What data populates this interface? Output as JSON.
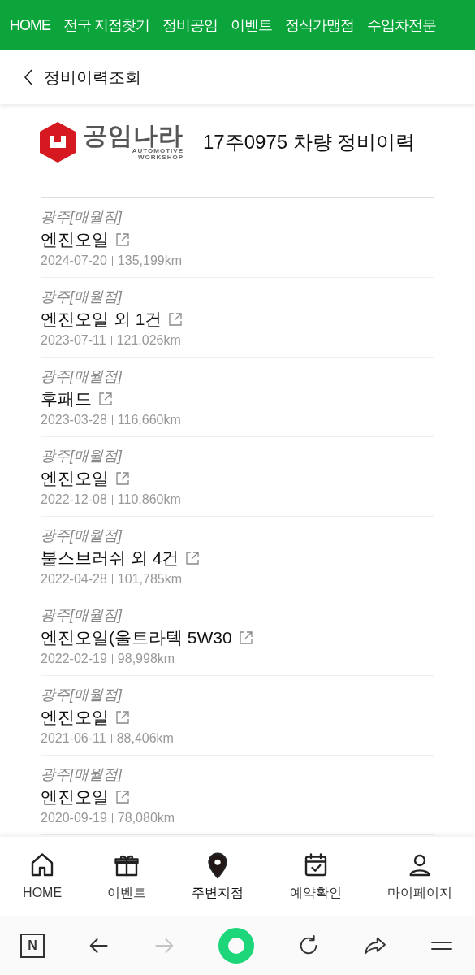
{
  "top_nav": [
    "HOME",
    "전국 지점찾기",
    "정비공임",
    "이벤트",
    "정식가맹점",
    "수입차전문"
  ],
  "header": {
    "title": "정비이력조회"
  },
  "logo": {
    "name": "공임나라",
    "sub1": "AUTOMOTIVE",
    "sub2": "WORKSHOP"
  },
  "page_title": "17주0975 차량 정비이력",
  "records": [
    {
      "branch": "광주[매월점]",
      "title": "엔진오일",
      "date": "2024-07-20",
      "km": "135,199km"
    },
    {
      "branch": "광주[매월점]",
      "title": "엔진오일 외 1건",
      "date": "2023-07-11",
      "km": "121,026km"
    },
    {
      "branch": "광주[매월점]",
      "title": "후패드",
      "date": "2023-03-28",
      "km": "116,660km"
    },
    {
      "branch": "광주[매월점]",
      "title": "엔진오일",
      "date": "2022-12-08",
      "km": "110,860km"
    },
    {
      "branch": "광주[매월점]",
      "title": "불스브러쉬 외 4건",
      "date": "2022-04-28",
      "km": "101,785km"
    },
    {
      "branch": "광주[매월점]",
      "title": "엔진오일(울트라텍 5W30",
      "date": "2022-02-19",
      "km": "98,998km"
    },
    {
      "branch": "광주[매월점]",
      "title": "엔진오일",
      "date": "2021-06-11",
      "km": "88,406km"
    },
    {
      "branch": "광주[매월점]",
      "title": "엔진오일",
      "date": "2020-09-19",
      "km": "78,080km"
    }
  ],
  "bottom_nav": [
    {
      "kind": "home",
      "label": "HOME",
      "selected": false
    },
    {
      "kind": "gift",
      "label": "이벤트",
      "selected": false
    },
    {
      "kind": "pin",
      "label": "주변지점",
      "selected": true
    },
    {
      "kind": "calendar",
      "label": "예약확인",
      "selected": false
    },
    {
      "kind": "user",
      "label": "마이페이지",
      "selected": false
    }
  ],
  "browser_bar": [
    {
      "kind": "n",
      "label": "N",
      "disabled": false
    },
    {
      "kind": "back",
      "disabled": false
    },
    {
      "kind": "forward",
      "disabled": true
    },
    {
      "kind": "home",
      "disabled": false
    },
    {
      "kind": "reload",
      "disabled": false
    },
    {
      "kind": "share",
      "disabled": false
    },
    {
      "kind": "menu",
      "disabled": false
    }
  ]
}
